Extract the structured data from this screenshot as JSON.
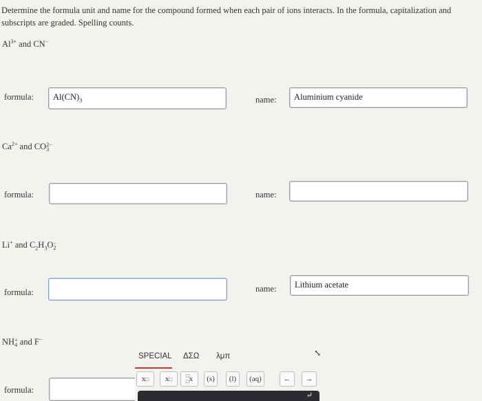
{
  "instructions": "Determine the formula unit and name for the compound formed when each pair of ions interacts. In the formula, capitalization and subscripts are graded. Spelling counts.",
  "questions": [
    {
      "ion1_base": "Al",
      "ion1_charge": "3+",
      "and": "and",
      "ion2_base": "CN",
      "ion2_charge": "−",
      "formula_label": "formula:",
      "formula_main": "Al(CN)",
      "formula_sub": "3",
      "name_label": "name:",
      "name_value": "Aluminium cyanide"
    },
    {
      "ion1_base": "Ca",
      "ion1_charge": "2+",
      "and": "and",
      "ion2_base": "CO",
      "ion2_sub": "3",
      "ion2_charge": "2−",
      "formula_label": "formula:",
      "name_label": "name:",
      "name_value": ""
    },
    {
      "ion1_base": "Li",
      "ion1_charge": "+",
      "and": "and",
      "ion2_p1": "C",
      "ion2_s1": "2",
      "ion2_p2": "H",
      "ion2_s2": "3",
      "ion2_p3": "O",
      "ion2_s3": "2",
      "ion2_charge": "−",
      "formula_label": "formula:",
      "name_label": "name:",
      "name_value": "Lithium acetate"
    },
    {
      "ion1_base": "NH",
      "ion1_sub": "4",
      "ion1_charge": "+",
      "and": "and",
      "ion2_base": "F",
      "ion2_charge": "−",
      "formula_label": "formula:"
    }
  ],
  "keyboard": {
    "tabs": [
      "SPECIAL",
      "ΔΣΩ",
      "λμπ"
    ],
    "keys": [
      "x□",
      "x□",
      "□x",
      "(s)",
      "(l)",
      "(aq)",
      "←",
      "→"
    ],
    "icons": [
      "collapse-icon",
      "arrow-left-icon",
      "arrow-right-icon",
      "enter-icon"
    ]
  }
}
